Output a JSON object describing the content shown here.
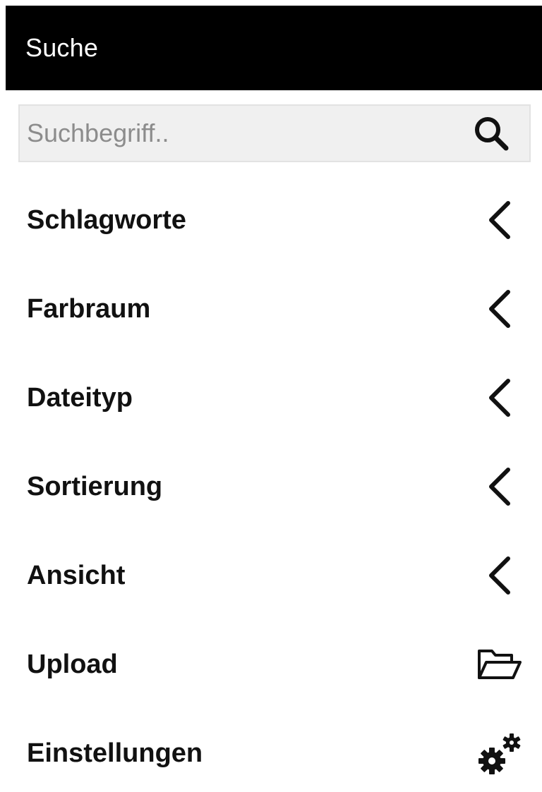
{
  "header": {
    "title": "Suche"
  },
  "search": {
    "placeholder": "Suchbegriff..",
    "value": "",
    "icon": "search-icon"
  },
  "menu": {
    "items": [
      {
        "label": "Schlagworte",
        "icon": "chevron-left-icon"
      },
      {
        "label": "Farbraum",
        "icon": "chevron-left-icon"
      },
      {
        "label": "Dateityp",
        "icon": "chevron-left-icon"
      },
      {
        "label": "Sortierung",
        "icon": "chevron-left-icon"
      },
      {
        "label": "Ansicht",
        "icon": "chevron-left-icon"
      },
      {
        "label": "Upload",
        "icon": "folder-open-icon"
      },
      {
        "label": "Einstellungen",
        "icon": "gears-icon"
      }
    ]
  },
  "colors": {
    "header_background": "#000000",
    "header_text": "#ffffff",
    "search_background": "#f0f0f0",
    "text": "#111111"
  }
}
